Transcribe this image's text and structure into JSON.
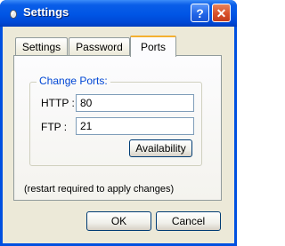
{
  "window": {
    "title": "Settings",
    "help_label": "?",
    "close_label": "✕"
  },
  "tabs": [
    {
      "label": "Settings",
      "active": false
    },
    {
      "label": "Password",
      "active": false
    },
    {
      "label": "Ports",
      "active": true
    }
  ],
  "ports": {
    "group_label": "Change Ports:",
    "http_label": "HTTP  :",
    "http_value": "80",
    "ftp_label": "FTP   :",
    "ftp_value": "21",
    "availability_label": "Availability"
  },
  "note": "(restart required to apply changes)",
  "buttons": {
    "ok_label": "OK",
    "cancel_label": "Cancel"
  }
}
